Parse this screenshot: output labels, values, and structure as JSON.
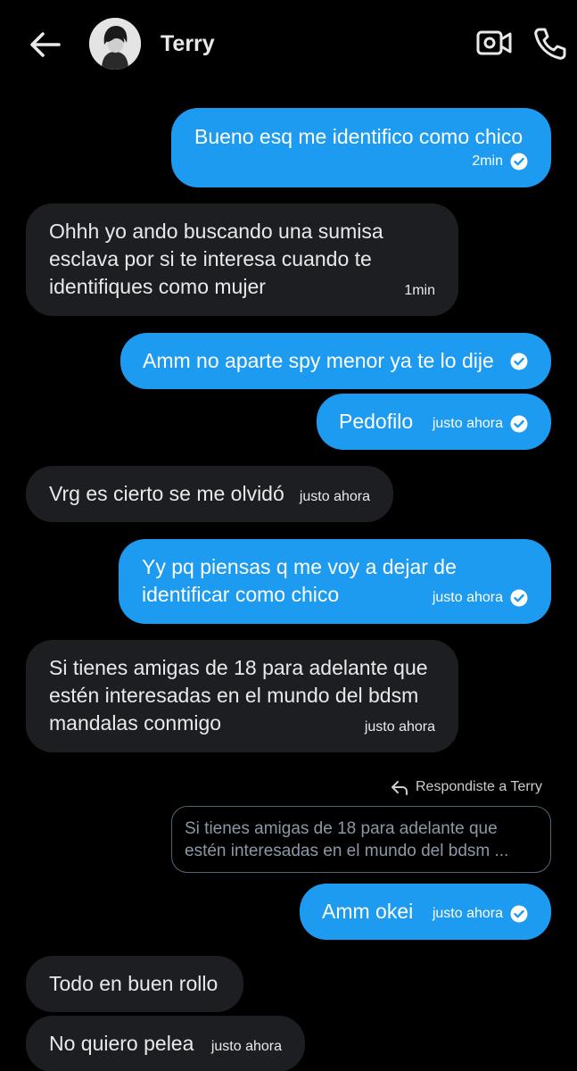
{
  "header": {
    "contact_name": "Terry",
    "back_icon": "arrow-left-icon",
    "video_icon": "video-camera-icon",
    "call_icon": "phone-icon"
  },
  "colors": {
    "outgoing": "#1d9bf0",
    "incoming": "#1c1e21",
    "background": "#000000"
  },
  "messages": [
    {
      "dir": "out",
      "lines": [
        "Bueno esq me identifico como chico"
      ],
      "time": "2min",
      "seen": true
    },
    {
      "dir": "in",
      "lines": [
        "Ohhh yo ando buscando una sumisa",
        "esclava por si te interesa cuando te",
        "identifiques como mujer"
      ],
      "time": "1min"
    },
    {
      "dir": "out",
      "lines": [
        "Amm no aparte spy menor ya te lo dije"
      ],
      "time": "",
      "seen": true
    },
    {
      "dir": "out",
      "lines": [
        "Pedofilo"
      ],
      "time": "justo ahora",
      "seen": true
    },
    {
      "dir": "in",
      "lines": [
        "Vrg es cierto se me olvidó"
      ],
      "time": "justo ahora"
    },
    {
      "dir": "out",
      "lines": [
        "Yy pq piensas q me voy a dejar de",
        "identificar como chico"
      ],
      "time": "justo ahora",
      "seen": true
    },
    {
      "dir": "in",
      "lines": [
        "Si tienes amigas de 18 para adelante que",
        "estén interesadas en el mundo del bdsm",
        "mandalas conmigo"
      ],
      "time": "justo ahora"
    },
    {
      "dir": "out",
      "lines": [
        "Amm okei"
      ],
      "time": "justo ahora",
      "seen": true
    },
    {
      "dir": "in",
      "lines": [
        "Todo en buen rollo"
      ],
      "time": ""
    },
    {
      "dir": "in",
      "lines": [
        "No quiero pelea"
      ],
      "time": "justo ahora"
    }
  ],
  "reply": {
    "label": "Respondiste a Terry",
    "icon": "reply-arrow-icon",
    "quote_lines": [
      "Si tienes amigas de 18 para adelante que",
      "estén interesadas en el mundo del bdsm ..."
    ]
  }
}
